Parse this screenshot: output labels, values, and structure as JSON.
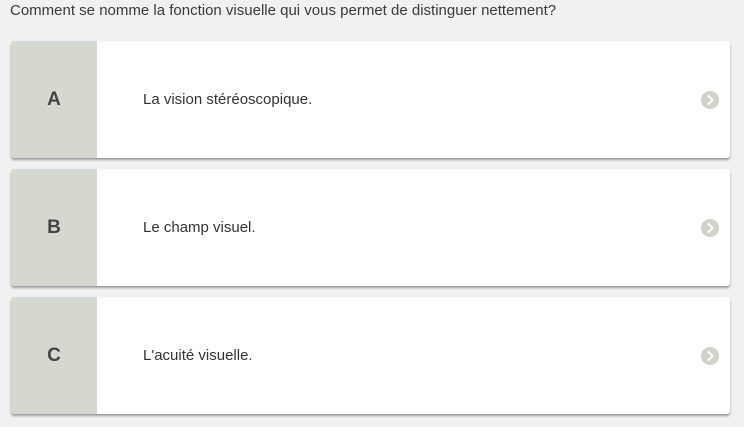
{
  "question": {
    "text": "Comment se nomme la fonction visuelle qui vous permet de distinguer nettement?"
  },
  "options": [
    {
      "letter": "A",
      "text": "La vision stéréoscopique.",
      "icon": "chevron-right-circle-icon"
    },
    {
      "letter": "B",
      "text": "Le champ visuel.",
      "icon": "chevron-right-circle-icon"
    },
    {
      "letter": "C",
      "text": "L'acuité visuelle.",
      "icon": "chevron-right-circle-icon"
    }
  ],
  "colors": {
    "background": "#f1f1f1",
    "letter_box": "#d5d8cf",
    "card": "#ffffff",
    "icon": "#cfd3c8"
  }
}
